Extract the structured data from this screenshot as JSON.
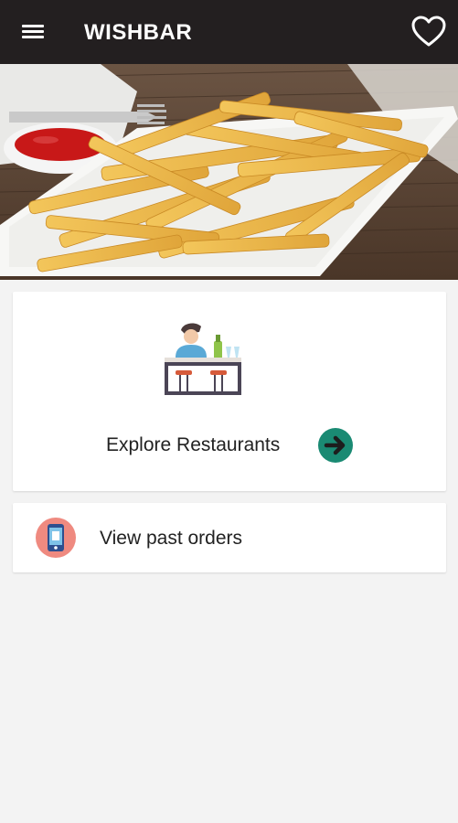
{
  "appbar": {
    "title": "WISHBAR",
    "menu_icon": "hamburger-menu-icon",
    "favorites_icon": "heart-outline-icon"
  },
  "hero": {
    "image": "french-fries-plate-with-ketchup"
  },
  "explore": {
    "label": "Explore Restaurants",
    "icon": "restaurant-bar-counter-icon",
    "action_icon": "arrow-right-circle-icon"
  },
  "orders": {
    "label": "View past orders",
    "icon": "mobile-phone-icon"
  },
  "colors": {
    "appbar_bg": "#231f20",
    "page_bg": "#f3f3f3",
    "accent_teal": "#1a8a73",
    "phone_icon_bg": "#ef8a80"
  }
}
